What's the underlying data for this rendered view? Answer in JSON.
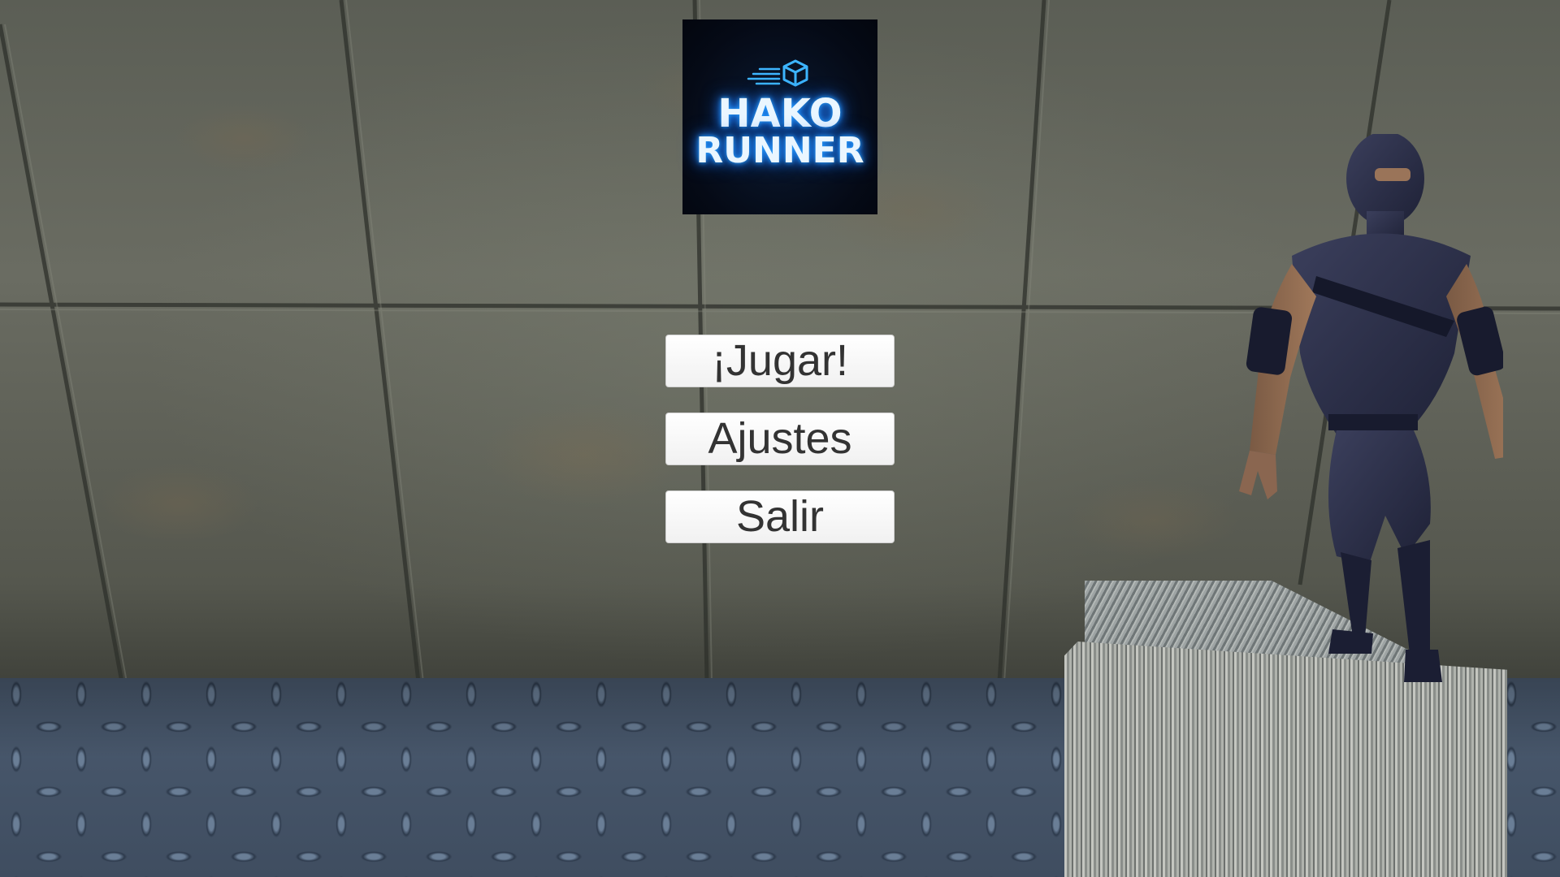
{
  "logo": {
    "line1": "HAKO",
    "line2": "RUNNER",
    "icon": "cube-speed-icon",
    "glow_color": "#2aa4ff",
    "background_color": "#050a16"
  },
  "menu": {
    "play_label": "¡Jugar!",
    "settings_label": "Ajustes",
    "exit_label": "Salir"
  },
  "scene": {
    "wall": "concrete-wall",
    "floor": "diamond-plate-floor",
    "prop": "metal-crate",
    "character": "ninja-character"
  }
}
